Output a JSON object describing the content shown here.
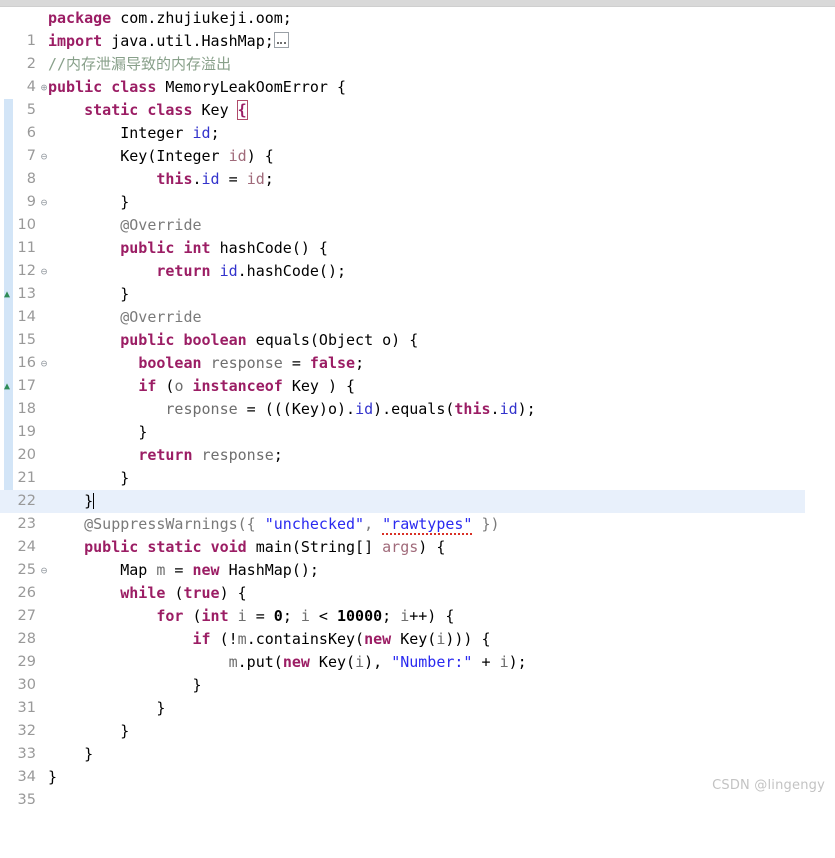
{
  "editor": {
    "language": "java",
    "watermark": "CSDN @lingengy",
    "current_line": 23,
    "caret_line": 23,
    "colors": {
      "background": "#ffffff",
      "keyword": "#9b1d64",
      "comment": "#88a08a",
      "string": "#2a2af0",
      "field": "#3333cc",
      "parameter": "#a06a7a",
      "local_variable": "#6e6e6e",
      "annotation": "#7a7a7a",
      "line_number": "#999999",
      "current_line_highlight": "#e8f0fb",
      "change_bar": "#c4dcf4",
      "fold_triangle": "#2e8b57",
      "error_squiggle": "#d93025"
    },
    "gutter": {
      "change_bar_start_line": 6,
      "change_bar_end_line": 23,
      "expand_marker_lines": [
        2
      ],
      "collapse_marker_lines": [
        6,
        8,
        11,
        15,
        24
      ],
      "override_triangle_lines": [
        12,
        16
      ]
    },
    "lines": [
      {
        "no": "1",
        "marker": "",
        "triangle": false,
        "indent": 0
      },
      {
        "no": "2",
        "marker": "+",
        "triangle": false,
        "indent": 0
      },
      {
        "no": "4",
        "marker": "",
        "triangle": false,
        "indent": 0
      },
      {
        "no": "5",
        "marker": "",
        "triangle": false,
        "indent": 0
      },
      {
        "no": "6",
        "marker": "-",
        "triangle": false,
        "indent": 1
      },
      {
        "no": "7",
        "marker": "",
        "triangle": false,
        "indent": 2
      },
      {
        "no": "8",
        "marker": "-",
        "triangle": false,
        "indent": 2
      },
      {
        "no": "9",
        "marker": "",
        "triangle": false,
        "indent": 3
      },
      {
        "no": "10",
        "marker": "",
        "triangle": false,
        "indent": 2
      },
      {
        "no": "11",
        "marker": "-",
        "triangle": false,
        "indent": 2
      },
      {
        "no": "12",
        "marker": "",
        "triangle": true,
        "indent": 2
      },
      {
        "no": "13",
        "marker": "",
        "triangle": false,
        "indent": 3
      },
      {
        "no": "14",
        "marker": "",
        "triangle": false,
        "indent": 2
      },
      {
        "no": "15",
        "marker": "-",
        "triangle": false,
        "indent": 2
      },
      {
        "no": "16",
        "marker": "",
        "triangle": true,
        "indent": 2
      },
      {
        "no": "17",
        "marker": "",
        "triangle": false,
        "indent": 3
      },
      {
        "no": "18",
        "marker": "",
        "triangle": false,
        "indent": 3
      },
      {
        "no": "19",
        "marker": "",
        "triangle": false,
        "indent": 4
      },
      {
        "no": "20",
        "marker": "",
        "triangle": false,
        "indent": 3
      },
      {
        "no": "21",
        "marker": "",
        "triangle": false,
        "indent": 3
      },
      {
        "no": "22",
        "marker": "",
        "triangle": false,
        "indent": 2
      },
      {
        "no": "23",
        "marker": "",
        "triangle": false,
        "indent": 1
      },
      {
        "no": "24",
        "marker": "-",
        "triangle": false,
        "indent": 1
      },
      {
        "no": "25",
        "marker": "",
        "triangle": false,
        "indent": 1
      },
      {
        "no": "26",
        "marker": "",
        "triangle": false,
        "indent": 2
      },
      {
        "no": "27",
        "marker": "",
        "triangle": false,
        "indent": 2
      },
      {
        "no": "28",
        "marker": "",
        "triangle": false,
        "indent": 3
      },
      {
        "no": "29",
        "marker": "",
        "triangle": false,
        "indent": 4
      },
      {
        "no": "30",
        "marker": "",
        "triangle": false,
        "indent": 5
      },
      {
        "no": "31",
        "marker": "",
        "triangle": false,
        "indent": 4
      },
      {
        "no": "32",
        "marker": "",
        "triangle": false,
        "indent": 3
      },
      {
        "no": "33",
        "marker": "",
        "triangle": false,
        "indent": 2
      },
      {
        "no": "34",
        "marker": "",
        "triangle": false,
        "indent": 1
      },
      {
        "no": "35",
        "marker": "",
        "triangle": false,
        "indent": 0
      }
    ],
    "code_text": {
      "l1": "package com.zhujiukeji.oom;",
      "l2": "import java.util.HashMap;",
      "l4": "//内存泄漏导致的内存溢出",
      "l5": "public class MemoryLeakOomError {",
      "l6": "    static class Key {",
      "l7": "        Integer id;",
      "l8": "        Key(Integer id) {",
      "l9": "            this.id = id;",
      "l10": "        }",
      "l11": "        @Override",
      "l12": "        public int hashCode() {",
      "l13": "            return id.hashCode();",
      "l14": "        }",
      "l15": "        @Override",
      "l16": "        public boolean equals(Object o) {",
      "l17": "            boolean response = false;",
      "l18": "            if (o instanceof Key) {",
      "l19": "                response = (((Key)o).id).equals(this.id);",
      "l20": "            }",
      "l21": "            return response;",
      "l22": "        }",
      "l23": "    }",
      "l24": "    @SuppressWarnings({ \"unchecked\", \"rawtypes\" })",
      "l25": "    public static void main(String[] args) {",
      "l26": "        Map m = new HashMap();",
      "l27": "        while (true) {",
      "l28": "            for (int i = 0; i < 10000; i++) {",
      "l29": "                if (!m.containsKey(new Key(i))) {",
      "l30": "                    m.put(new Key(i), \"Number:\" + i);",
      "l31": "                }",
      "l32": "            }",
      "l33": "        }",
      "l34": "    }",
      "l35": "}"
    },
    "tokens": {
      "kw_package": "package",
      "kw_import": "import",
      "kw_public": "public",
      "kw_class": "class",
      "kw_static": "static",
      "kw_this": "this",
      "kw_int": "int",
      "kw_return": "return",
      "kw_boolean": "boolean",
      "kw_false": "false",
      "kw_true": "true",
      "kw_if": "if",
      "kw_instanceof": "instanceof",
      "kw_void": "void",
      "kw_new": "new",
      "kw_while": "while",
      "kw_for": "for",
      "pkg_name": "com.zhujiukeji.oom;",
      "import_name": "java.util.HashMap;",
      "comment_l4": "//内存泄漏导致的内存溢出",
      "class_name": "MemoryLeakOomError {",
      "key_class": "Key ",
      "type_integer": "Integer ",
      "field_id": "id",
      "semi": ";",
      "ctor_key": "Key(",
      "param_id": "id",
      "ann_override": "@Override",
      "ann_suppress": "@SuppressWarnings({ ",
      "str_unchecked": "\"unchecked\"",
      "str_rawtypes": "\"rawtypes\"",
      "str_number": "\"Number:\"",
      "hashcode_sig": "hashCode() {",
      "hashcode_call": ".hashCode();",
      "equals_sig": "equals(Object o) {",
      "var_response": "response",
      "cast_expr": " = (((Key)o).",
      "equals_call": ").equals(",
      "main_sig": "main(String[] args) {",
      "map_decl": "Map ",
      "var_m": "m",
      "hashmap_new": " HashMap();",
      "var_i": "i",
      "num_0": "0",
      "num_10000": "10000",
      "contains_key": ".containsKey(",
      "put_call": ".put(",
      "brace_open": "{",
      "brace_close": "}"
    }
  }
}
